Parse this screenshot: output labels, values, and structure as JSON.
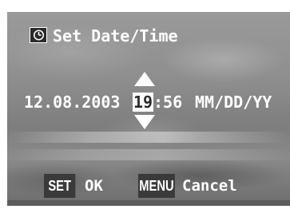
{
  "screen": {
    "title": "Set Date/Time",
    "icon": "clock-icon"
  },
  "datetime": {
    "date": "12.08.2003",
    "hour": "19",
    "minutes": ":56",
    "format": "MM/DD/YY",
    "selected_field": "hour"
  },
  "adjust": {
    "up_icon": "arrow-up-icon",
    "down_icon": "arrow-down-icon"
  },
  "footer": {
    "set_key": "SET",
    "set_action": "OK",
    "menu_key": "MENU",
    "menu_action": "Cancel"
  },
  "colors": {
    "text": "#ffffff",
    "highlight_bg": "#ffffff",
    "highlight_text": "#2b2b2b",
    "key_bg": "#3a3a3a"
  }
}
